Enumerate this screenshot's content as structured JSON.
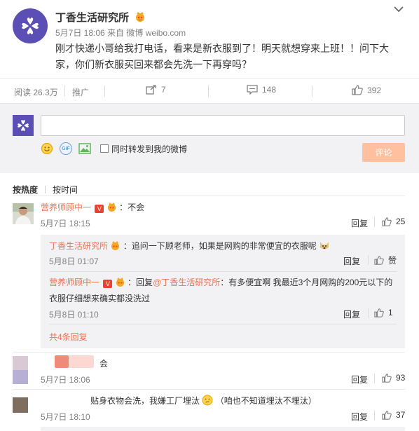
{
  "post": {
    "author": "丁香生活研究所",
    "meta": "5月7日 18:06 来自 微博 weibo.com",
    "content": "刚才快递小哥给我打电话，看来是新衣服到了！明天就想穿来上班！！问下大家，你们新衣服买回来都会先洗一下再穿吗？"
  },
  "actions": {
    "reads": "阅读 26.3万",
    "promote": "推广",
    "reposts": "7",
    "comments": "148",
    "likes": "392"
  },
  "composer": {
    "checkbox_label": "同时转发到我的微博",
    "submit_label": "评论",
    "gif_label": "GIF"
  },
  "sort": {
    "hot": "按热度",
    "time": "按时间"
  },
  "comments": [
    {
      "name": "营养师顾中一",
      "sep": "：",
      "text": "不会",
      "time": "5月7日 18:15",
      "reply": "回复",
      "likes": "25",
      "replies": [
        {
          "name": "丁香生活研究所",
          "sep": "：",
          "text": "追问一下顾老师，如果是网购的非常便宜的衣服呢",
          "time": "5月8日 01:07",
          "reply": "回复",
          "likes": "赞"
        },
        {
          "name": "营养师顾中一",
          "sep": "：回复",
          "target": "@丁香生活研究所",
          "text": "：有多便宜啊 我最近3个月网购的200元以下的",
          "text2": "衣服仔细想来确实都没洗过",
          "time": "5月8日 01:10",
          "reply": "回复",
          "likes": "1"
        }
      ],
      "more": "共4条回复"
    },
    {
      "text": "会",
      "time": "5月7日 18:06",
      "reply": "回复",
      "likes": "93"
    },
    {
      "text": "贴身衣物会洗，我嫌工厂埋汰",
      "text_after": "（咱也不知道埋汰不埋汰）",
      "time": "5月7日 18:10",
      "reply": "回复",
      "likes": "37"
    }
  ],
  "colors": {
    "accent": "#eb7350",
    "brand_purple": "#5b4eb5",
    "submit_disabled": "#ffc09f"
  }
}
